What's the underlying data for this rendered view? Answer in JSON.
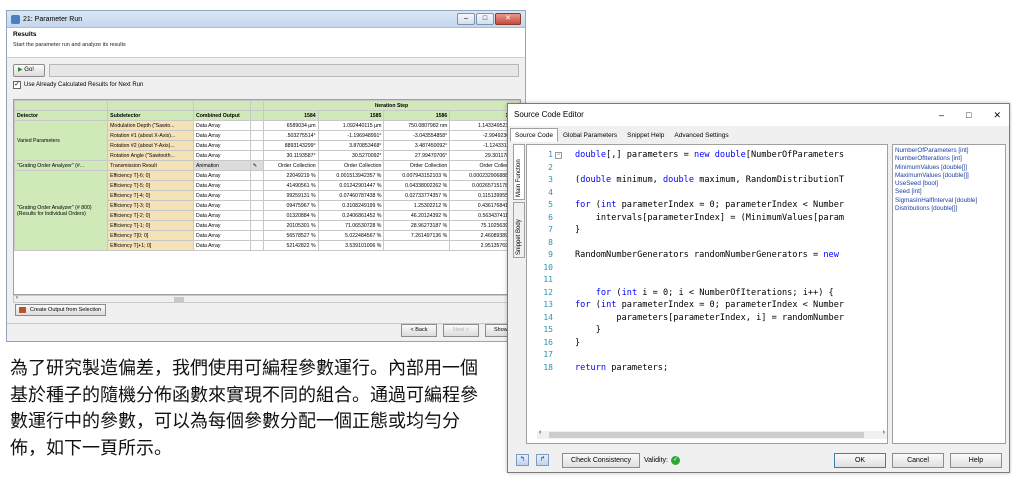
{
  "run_window": {
    "title": "21: Parameter Run",
    "header_title": "Results",
    "header_subtitle": "Start the parameter run and analyze its results",
    "go_label": "Go!",
    "use_calculated_label": "Use Already Calculated Results for Next Run",
    "table": {
      "headers": [
        "Detector",
        "Subdetector",
        "Combined Output",
        "Iteration Step"
      ],
      "iteration_steps": [
        "1584",
        "1585",
        "1586",
        "1587"
      ],
      "varied_parameters_label": "Varied Parameters",
      "grating_analyzer_label": "\"Grating Order Analyzer\" (#...",
      "grating_analyzer_group": "\"Grating Order Analyzer\" (# 800) (Results for Individual Orders)",
      "rows": [
        {
          "sub": "Modulation  Depth (\"Sawto...",
          "out": "Data Array",
          "vals": [
            "6589034 µm",
            "1.092440115 µm",
            "750.0807982 nm",
            "1.143349523 µm"
          ]
        },
        {
          "sub": "Rotation #1 (about X-Axis)...",
          "out": "Data Array",
          "vals": [
            ".503275514°",
            "-1.196948991°",
            "-3.043554858°",
            "-2.994923633°"
          ]
        },
        {
          "sub": "Rotation #2 (about Y-Axis)...",
          "out": "Data Array",
          "vals": [
            "8893143299°",
            "3.870853468°",
            "3.487450092°",
            "-1.124331136°"
          ]
        },
        {
          "sub": "Rotation  Angle (\"Sawtooth...",
          "out": "Data Array",
          "vals": [
            "30.1193587°",
            "30.5270092°",
            "27.99470706°",
            "29.30117893°"
          ]
        },
        {
          "sub": "Transmission Result",
          "out": "Animation",
          "vals": [
            "Order Collection",
            "Order Collection",
            "Order Collection",
            "Order Collection"
          ]
        },
        {
          "sub": "Efficiency T[-6; 0]",
          "out": "Data Array",
          "vals": [
            "22049219 %",
            "0.001513942357 %",
            "0.007943152103 %",
            "0.0002329068886 %"
          ]
        },
        {
          "sub": "Efficiency T[-5; 0]",
          "out": "Data Array",
          "vals": [
            "41490561 %",
            "0.01242901447 %",
            "0.04338002262 %",
            "0.002657151786 %"
          ]
        },
        {
          "sub": "Efficiency T[-4; 0]",
          "out": "Data Array",
          "vals": [
            "99259131 %",
            "0.07460787438 %",
            "0.02733774357 %",
            "0.1151399559 %"
          ]
        },
        {
          "sub": "Efficiency T[-3; 0]",
          "out": "Data Array",
          "vals": [
            "09475967 %",
            "0.3108249199 %",
            "1.25302212 %",
            "0.4361768419 %"
          ]
        },
        {
          "sub": "Efficiency T[-2; 0]",
          "out": "Data Array",
          "vals": [
            "01320884 %",
            "0.2406861452 %",
            "46.20124392 %",
            "0.5634374119 %"
          ]
        },
        {
          "sub": "Efficiency T[-1; 0]",
          "out": "Data Array",
          "vals": [
            "20105301 %",
            "71.06530728 %",
            "28.96273187 %",
            "75.10256396 %"
          ]
        },
        {
          "sub": "Efficiency T[0; 0]",
          "out": "Data Array",
          "vals": [
            "56578527 %",
            "5.022484567 %",
            "7.261497136 %",
            "2.460893894 %"
          ]
        },
        {
          "sub": "Efficiency T[+1; 0]",
          "out": "Data Array",
          "vals": [
            "52142822 %",
            "3.539101006 %",
            "",
            "2.951357697 %"
          ]
        }
      ]
    },
    "create_output_label": "Create Output from Selection",
    "back_label": "< Back",
    "next_label": "Next >",
    "show_label": "Show ▸"
  },
  "paragraph": "為了研究製造偏差，我們使用可編程參數運行。內部用一個基於種子的隨機分佈函數來實現不同的組合。通過可編程參數運行中的參數，可以為每個參數分配一個正態或均勻分佈，如下一頁所示。",
  "editor_window": {
    "title": "Source Code Editor",
    "tabs": [
      "Source Code",
      "Global Parameters",
      "Snippet Help",
      "Advanced Settings"
    ],
    "vertical_tabs": [
      "Main Function",
      "Snippet Body"
    ],
    "line_numbers": [
      "1",
      "2",
      "3",
      "4",
      "5",
      "6",
      "7",
      "8",
      "9",
      "10",
      "11",
      "12",
      "13",
      "14",
      "15",
      "16",
      "17",
      "18"
    ],
    "code_lines": [
      "double[,] parameters = new double[NumberOfParameters",
      "",
      "(double minimum, double maximum, RandomDistributionT",
      "",
      "for (int parameterIndex = 0; parameterIndex < Number",
      "    intervals[parameterIndex] = (MinimumValues[param",
      "}",
      "",
      "RandomNumberGenerators randomNumberGenerators = new",
      "",
      "",
      "    for (int i = 0; i < NumberOfIterations; i++) {",
      "for (int parameterIndex = 0; parameterIndex < Number",
      "        parameters[parameterIndex, i] = randomNumber",
      "    }",
      "}",
      "",
      "return parameters;"
    ],
    "global_params": [
      "NumberOfParameters [int]",
      "NumberOfIterations [int]",
      "MinimumValues [double[]]",
      "MaximumValues [double[]]",
      "UseSeed [bool]",
      "Seed [int]",
      "SigmasInHalfInterval [double]",
      "Distributions [double[]]"
    ],
    "check_label": "Check Consistency",
    "validity_label": "Validity:",
    "ok_label": "OK",
    "cancel_label": "Cancel",
    "help_label": "Help"
  }
}
